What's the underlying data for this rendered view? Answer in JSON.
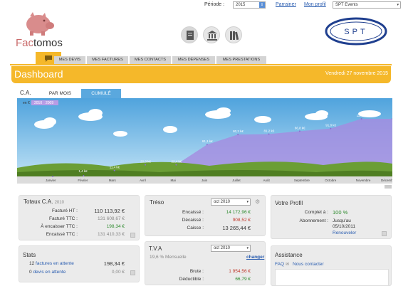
{
  "app": {
    "logo": "Factomos",
    "logo_part1": "Fac",
    "logo_part2": "tomos"
  },
  "topbar": {
    "period_label": "Période :",
    "period_value": "2015",
    "link1": "Parrainer",
    "link2": "Mon profil",
    "account": "SPT Events"
  },
  "spt_logo": "SPT",
  "colors": {
    "accent": "#f5b82a",
    "link": "#2a5db0",
    "chart_fill": "#a58be0"
  },
  "menu": {
    "items": [
      "MES DEVIS",
      "MES FACTURES",
      "MES CONTACTS",
      "MES DÉPENSES",
      "MES PRESTATIONS"
    ]
  },
  "dashboard": {
    "title": "Dashboard",
    "date": "Vendredi 27 novembre 2015"
  },
  "ca_section": {
    "title": "C.A.",
    "tab1": "PAR MOIS",
    "tab2": "CUMULÉ"
  },
  "chart_data": {
    "type": "area",
    "categories": [
      "Janvier",
      "Février",
      "Mars",
      "Avril",
      "Mai",
      "Juin",
      "Juillet",
      "Août",
      "Septembre",
      "Octobre",
      "Novembre",
      "Décembre"
    ],
    "series": [
      {
        "name": "2010",
        "values": [
          0,
          1.4,
          11.4,
          22.3,
          22.4,
          61.1,
          80.3,
          81.2,
          86.8,
          91.8,
          110.5,
          110.5
        ]
      },
      {
        "name": "2009",
        "values": []
      }
    ],
    "value_labels": [
      "",
      "1,4 k€",
      "11,4 k€",
      "22,3 k€",
      "22,4 k€",
      "61,1 k€",
      "80,3 k€",
      "81,2 k€",
      "86,8 k€",
      "91,8 k€",
      "110,5 k€",
      ""
    ],
    "ylabel": "en €",
    "legend": [
      "2010",
      "2009"
    ]
  },
  "totaux": {
    "title": "Totaux C.A.",
    "year": "2010",
    "rows": [
      {
        "label": "Facturé HT :",
        "value": "110 113,92 €"
      },
      {
        "label": "Facturé TTC :",
        "value": "131 608,67 €"
      },
      {
        "label": "À encaisser TTC :",
        "value": "198,34 €"
      },
      {
        "label": "Encaissé TTC :",
        "value": "131 410,33 €"
      }
    ]
  },
  "treso": {
    "title": "Tréso",
    "select": "oct 2010",
    "rows": [
      {
        "label": "Encaissé :",
        "value": "14 172,96 €"
      },
      {
        "label": "Décaissé :",
        "value": "908,52 €"
      },
      {
        "label": "Caisse :",
        "value": "13 265,44 €"
      }
    ]
  },
  "profil": {
    "title": "Votre Profil",
    "complete_label": "Complet à :",
    "complete_value": "100 %",
    "abonnement_label": "Abonnement :",
    "abonnement_value1": "Jusqu'au",
    "abonnement_value2": "05/10/2011",
    "renew": "Renouveler"
  },
  "stats": {
    "title": "Stats",
    "rows": [
      {
        "count": "12",
        "label": "factures en attente",
        "value": "198,34 €"
      },
      {
        "count": "0",
        "label": "devis en attente",
        "value": "0,00 €"
      }
    ]
  },
  "tva": {
    "title": "T.V.A",
    "subtitle": "19,6 % Mensuelle",
    "select": "oct 2010",
    "change": "changer",
    "rows": [
      {
        "label": "Brute :",
        "value": "1 954,56 €"
      },
      {
        "label": "Déductible :",
        "value": "66,79 €"
      }
    ]
  },
  "assistance": {
    "title": "Assistance",
    "faq": "FAQ",
    "contact": "Nous contacter"
  }
}
